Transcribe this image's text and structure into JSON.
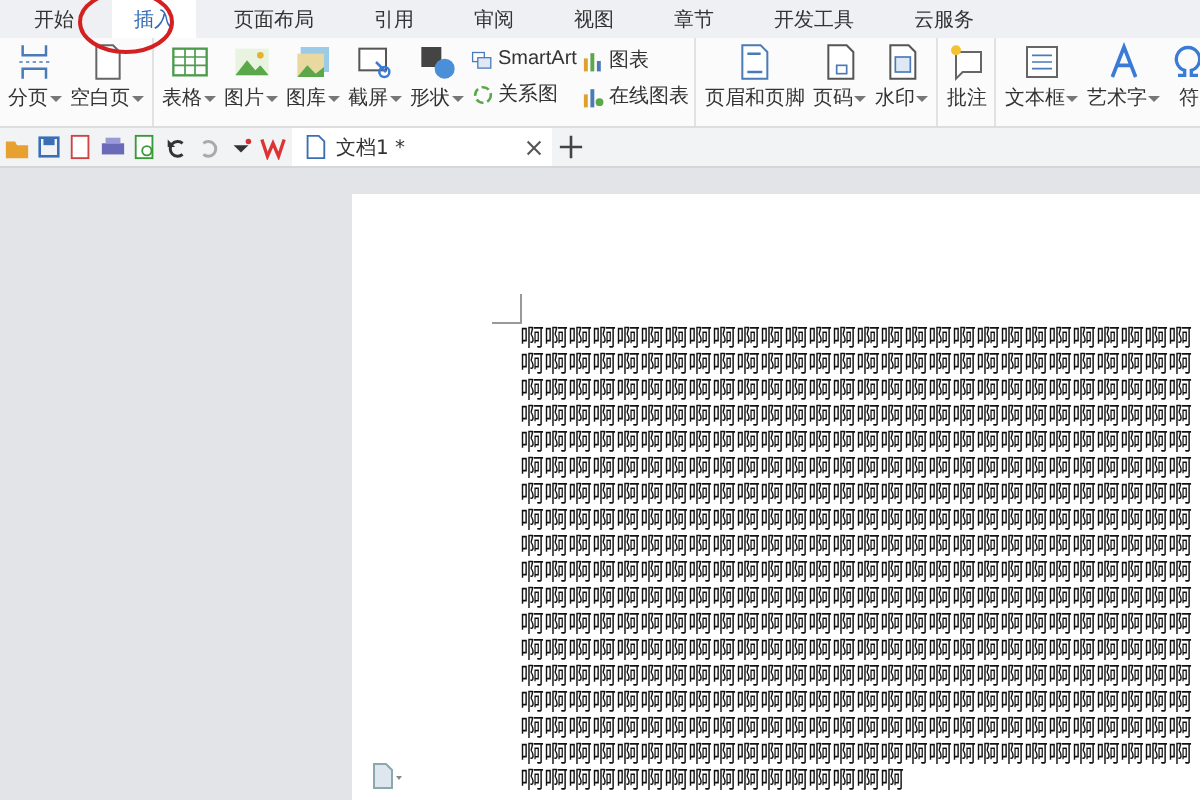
{
  "tabs": [
    {
      "label": "开始",
      "selected": false
    },
    {
      "label": "插入",
      "selected": true
    },
    {
      "label": "页面布局",
      "selected": false
    },
    {
      "label": "引用",
      "selected": false
    },
    {
      "label": "审阅",
      "selected": false
    },
    {
      "label": "视图",
      "selected": false
    },
    {
      "label": "章节",
      "selected": false
    },
    {
      "label": "开发工具",
      "selected": false
    },
    {
      "label": "云服务",
      "selected": false
    }
  ],
  "ribbon_groups": [
    {
      "items": [
        {
          "kind": "large",
          "label": "分页",
          "dropdown": true
        },
        {
          "kind": "large",
          "label": "空白页",
          "dropdown": true
        }
      ]
    },
    {
      "items": [
        {
          "kind": "large",
          "label": "表格",
          "dropdown": true
        },
        {
          "kind": "large",
          "label": "图片",
          "dropdown": true
        },
        {
          "kind": "large",
          "label": "图库",
          "dropdown": true
        },
        {
          "kind": "large",
          "label": "截屏",
          "dropdown": true
        },
        {
          "kind": "large",
          "label": "形状",
          "dropdown": true
        },
        {
          "kind": "stack",
          "entries": [
            {
              "label": "SmartArt"
            },
            {
              "label": "关系图"
            }
          ]
        },
        {
          "kind": "stack",
          "entries": [
            {
              "label": "图表"
            },
            {
              "label": "在线图表"
            }
          ]
        }
      ]
    },
    {
      "items": [
        {
          "kind": "large",
          "label": "页眉和页脚",
          "dropdown": false
        },
        {
          "kind": "large",
          "label": "页码",
          "dropdown": true
        },
        {
          "kind": "large",
          "label": "水印",
          "dropdown": true
        }
      ]
    },
    {
      "items": [
        {
          "kind": "large",
          "label": "批注",
          "dropdown": false
        }
      ]
    },
    {
      "items": [
        {
          "kind": "large",
          "label": "文本框",
          "dropdown": true
        },
        {
          "kind": "large",
          "label": "艺术字",
          "dropdown": true
        },
        {
          "kind": "large",
          "label": "符",
          "dropdown": false
        }
      ]
    }
  ],
  "document_tab": {
    "title": "文档1 *"
  },
  "document_lines": [
    "啊啊啊啊啊啊啊啊啊啊啊啊啊啊啊啊啊啊啊啊啊啊啊啊啊啊啊啊",
    "啊啊啊啊啊啊啊啊啊啊啊啊啊啊啊啊啊啊啊啊啊啊啊啊啊啊啊啊",
    "啊啊啊啊啊啊啊啊啊啊啊啊啊啊啊啊啊啊啊啊啊啊啊啊啊啊啊啊",
    "啊啊啊啊啊啊啊啊啊啊啊啊啊啊啊啊啊啊啊啊啊啊啊啊啊啊啊啊",
    "啊啊啊啊啊啊啊啊啊啊啊啊啊啊啊啊啊啊啊啊啊啊啊啊啊啊啊啊",
    "啊啊啊啊啊啊啊啊啊啊啊啊啊啊啊啊啊啊啊啊啊啊啊啊啊啊啊啊",
    "啊啊啊啊啊啊啊啊啊啊啊啊啊啊啊啊啊啊啊啊啊啊啊啊啊啊啊啊",
    "啊啊啊啊啊啊啊啊啊啊啊啊啊啊啊啊啊啊啊啊啊啊啊啊啊啊啊啊",
    "啊啊啊啊啊啊啊啊啊啊啊啊啊啊啊啊啊啊啊啊啊啊啊啊啊啊啊啊",
    "啊啊啊啊啊啊啊啊啊啊啊啊啊啊啊啊啊啊啊啊啊啊啊啊啊啊啊啊",
    "啊啊啊啊啊啊啊啊啊啊啊啊啊啊啊啊啊啊啊啊啊啊啊啊啊啊啊啊",
    "啊啊啊啊啊啊啊啊啊啊啊啊啊啊啊啊啊啊啊啊啊啊啊啊啊啊啊啊",
    "啊啊啊啊啊啊啊啊啊啊啊啊啊啊啊啊啊啊啊啊啊啊啊啊啊啊啊啊",
    "啊啊啊啊啊啊啊啊啊啊啊啊啊啊啊啊啊啊啊啊啊啊啊啊啊啊啊啊",
    "啊啊啊啊啊啊啊啊啊啊啊啊啊啊啊啊啊啊啊啊啊啊啊啊啊啊啊啊",
    "啊啊啊啊啊啊啊啊啊啊啊啊啊啊啊啊啊啊啊啊啊啊啊啊啊啊啊啊",
    "啊啊啊啊啊啊啊啊啊啊啊啊啊啊啊啊啊啊啊啊啊啊啊啊啊啊啊啊",
    "啊啊啊啊啊啊啊啊啊啊啊啊啊啊啊啊"
  ]
}
